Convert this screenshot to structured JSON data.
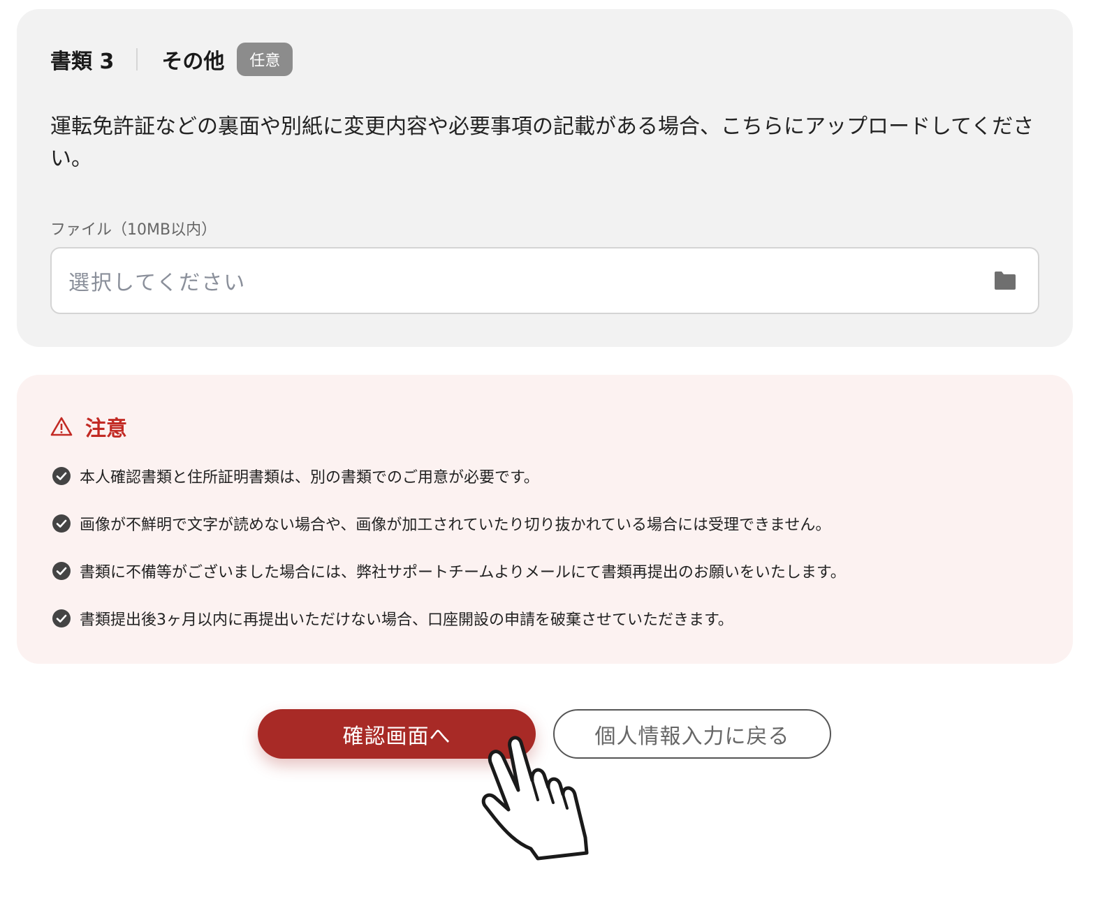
{
  "document_section": {
    "number": "書類 3",
    "title": "その他",
    "badge": "任意",
    "description": "運転免許証などの裏面や別紙に変更内容や必要事項の記載がある場合、こちらにアップロードしてください。",
    "file_label": "ファイル（10MB以内）",
    "file_placeholder": "選択してください",
    "file_icon": "folder-icon"
  },
  "notice": {
    "title": "注意",
    "icon": "warning-icon",
    "items": [
      "本人確認書類と住所証明書類は、別の書類でのご用意が必要です。",
      "画像が不鮮明で文字が読めない場合や、画像が加工されていたり切り抜かれている場合には受理できません。",
      "書類に不備等がございました場合には、弊社サポートチームよりメールにて書類再提出のお願いをいたします。",
      "書類提出後3ヶ月以内に再提出いただけない場合、口座開設の申請を破棄させていただきます。"
    ],
    "item_icon": "check-circle-icon",
    "accent_color": "#c22a24",
    "background_color": "#fcf2f1"
  },
  "actions": {
    "confirm_label": "確認画面へ",
    "back_label": "個人情報入力に戻る",
    "confirm_color": "#a82a26",
    "cursor_icon": "pointing-hand-cursor-icon"
  }
}
